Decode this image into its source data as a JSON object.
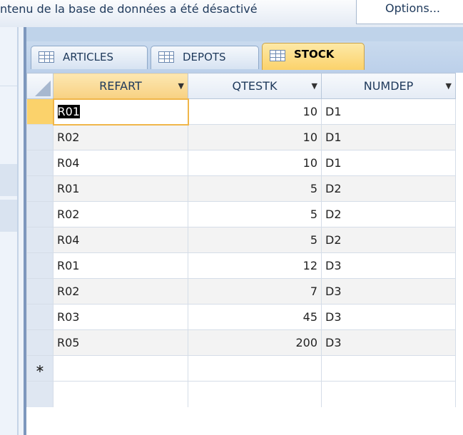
{
  "message_bar": {
    "text": "ntenu de la base de données a été désactivé",
    "options_label": "Options..."
  },
  "tabs": [
    {
      "label": "ARTICLES",
      "active": false
    },
    {
      "label": "DEPOTS",
      "active": false
    },
    {
      "label": "STOCK",
      "active": true
    }
  ],
  "grid": {
    "columns": [
      "REFART",
      "QTESTK",
      "NUMDEP"
    ],
    "rows": [
      {
        "refart": "R01",
        "qtestk": "10",
        "numdep": "D1"
      },
      {
        "refart": "R02",
        "qtestk": "10",
        "numdep": "D1"
      },
      {
        "refart": "R04",
        "qtestk": "10",
        "numdep": "D1"
      },
      {
        "refart": "R01",
        "qtestk": "5",
        "numdep": "D2"
      },
      {
        "refart": "R02",
        "qtestk": "5",
        "numdep": "D2"
      },
      {
        "refart": "R04",
        "qtestk": "5",
        "numdep": "D2"
      },
      {
        "refart": "R01",
        "qtestk": "12",
        "numdep": "D3"
      },
      {
        "refart": "R02",
        "qtestk": "7",
        "numdep": "D3"
      },
      {
        "refart": "R03",
        "qtestk": "45",
        "numdep": "D3"
      },
      {
        "refart": "R05",
        "qtestk": "200",
        "numdep": "D3"
      }
    ],
    "new_row_marker": "∗"
  },
  "icons": {
    "table_icon": "datasheet-table-icon",
    "dropdown_icon": "chevron-down-icon"
  },
  "colors": {
    "active_tab": "#fbd26b",
    "current_cell_border": "#f0b64a",
    "frame_blue": "#bfd3ea"
  }
}
